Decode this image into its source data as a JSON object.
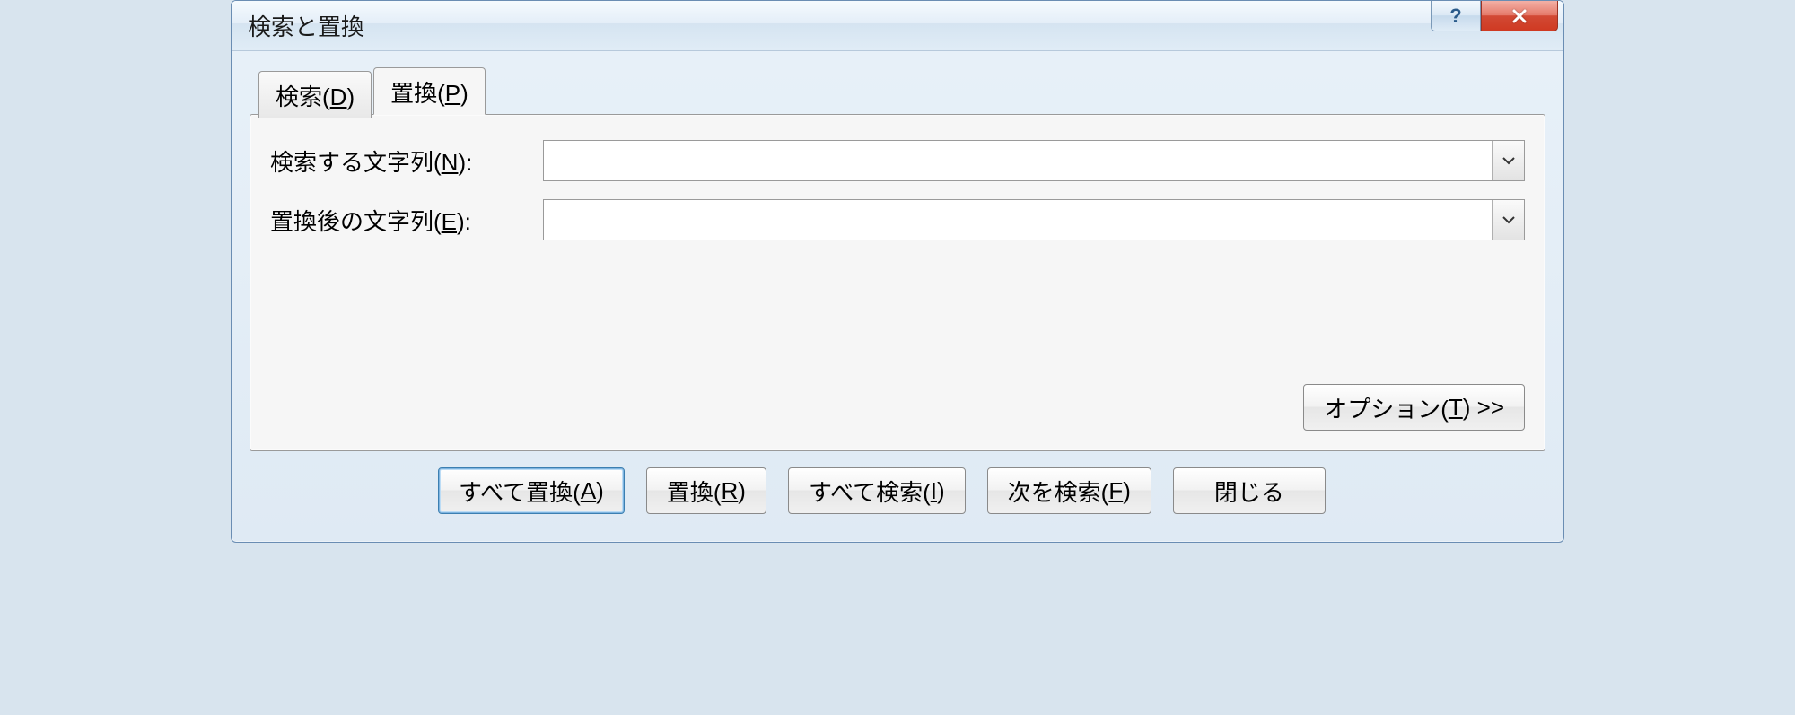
{
  "window": {
    "title": "検索と置換"
  },
  "tabs": {
    "find": {
      "label_pre": "検索(",
      "key": "D",
      "label_post": ")"
    },
    "replace": {
      "label_pre": "置換(",
      "key": "P",
      "label_post": ")"
    },
    "active": "replace"
  },
  "form": {
    "find_label_pre": "検索する文字列(",
    "find_key": "N",
    "find_label_post": "):",
    "find_value": "",
    "replace_label_pre": "置換後の文字列(",
    "replace_key": "E",
    "replace_label_post": "):",
    "replace_value": ""
  },
  "options_button": {
    "pre": "オプション(",
    "key": "T",
    "post": ") >>"
  },
  "buttons": {
    "replace_all": {
      "pre": "すべて置換(",
      "key": "A",
      "post": ")"
    },
    "replace": {
      "pre": "置換(",
      "key": "R",
      "post": ")"
    },
    "find_all": {
      "pre": "すべて検索(",
      "key": "I",
      "post": ")"
    },
    "find_next": {
      "pre": "次を検索(",
      "key": "F",
      "post": ")"
    },
    "close": {
      "label": "閉じる"
    }
  }
}
